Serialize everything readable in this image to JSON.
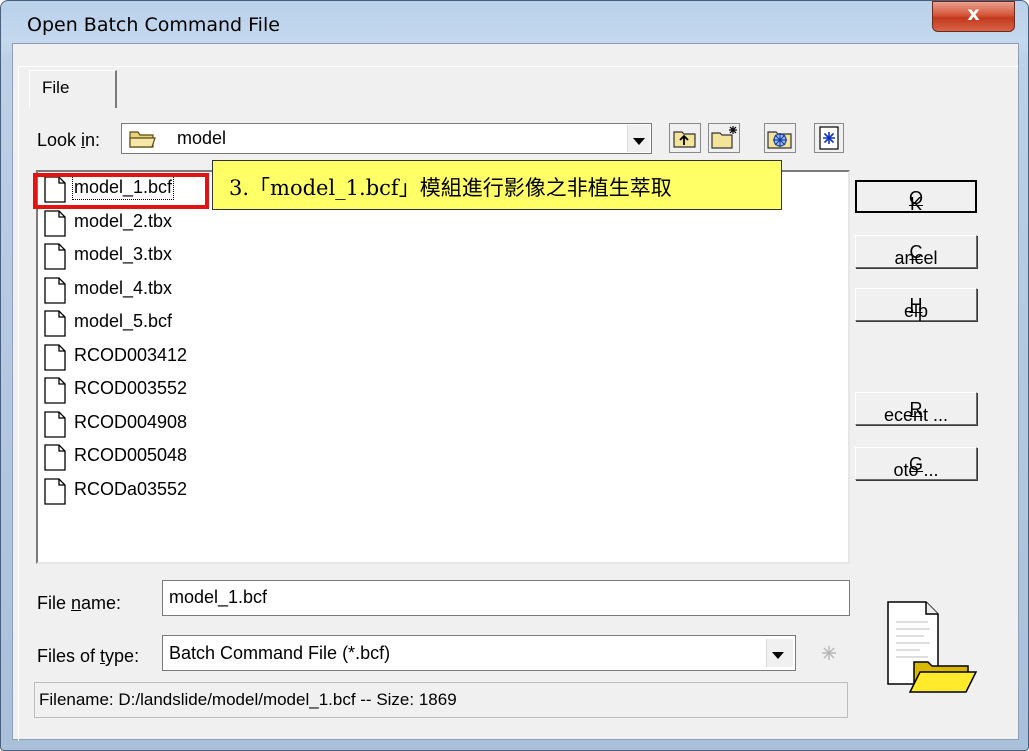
{
  "window": {
    "title": "Open Batch Command File",
    "close_label": "x"
  },
  "tabs": [
    {
      "label": "File"
    }
  ],
  "look_in": {
    "label_pre": "Look ",
    "label_key": "i",
    "label_post": "n:",
    "value": "model"
  },
  "files": [
    {
      "name": "model_1.bcf",
      "selected": true
    },
    {
      "name": "model_2.tbx"
    },
    {
      "name": "model_3.tbx"
    },
    {
      "name": "model_4.tbx"
    },
    {
      "name": "model_5.bcf"
    },
    {
      "name": "RCOD003412"
    },
    {
      "name": "RCOD003552"
    },
    {
      "name": "RCOD004908"
    },
    {
      "name": "RCOD005048"
    },
    {
      "name": "RCODa03552"
    }
  ],
  "callout": {
    "text": "3.「model_1.bcf」模組進行影像之非植生萃取"
  },
  "buttons": {
    "ok": {
      "key": "O",
      "rest": "K"
    },
    "cancel": {
      "key": "C",
      "rest": "ancel"
    },
    "help": {
      "key": "H",
      "rest": "elp"
    },
    "recent": {
      "key": "R",
      "rest": "ecent ..."
    },
    "goto": {
      "key": "G",
      "rest": "oto ..."
    }
  },
  "file_name": {
    "label_pre": "File ",
    "label_key": "n",
    "label_post": "ame:",
    "value": "model_1.bcf"
  },
  "file_type": {
    "label_pre": "Files of ",
    "label_key": "t",
    "label_post": "ype:",
    "value": "Batch Command File (*.bcf)"
  },
  "status": {
    "text": "Filename: D:/landslide/model/model_1.bcf -- Size: 1869"
  },
  "icons": [
    "folder-icon",
    "up-folder-icon",
    "new-folder-icon",
    "snowflake-icon",
    "asterisk-icon",
    "document-folder-icon"
  ]
}
